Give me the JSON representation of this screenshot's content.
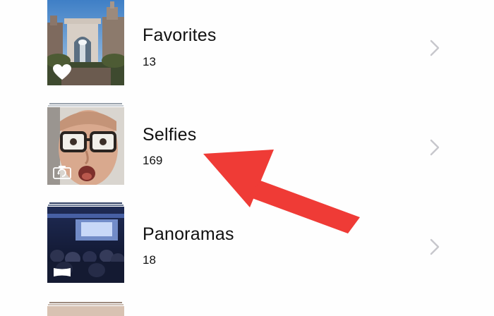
{
  "albums": [
    {
      "title": "Favorites",
      "count": "13",
      "badge_icon": "heart-icon"
    },
    {
      "title": "Selfies",
      "count": "169",
      "badge_icon": "front-camera-icon"
    },
    {
      "title": "Panoramas",
      "count": "18",
      "badge_icon": "panorama-icon"
    }
  ],
  "colors": {
    "annotation_arrow": "#ef3b36",
    "chevron": "#c7c7cc",
    "text": "#111111",
    "background": "#fefefe"
  }
}
